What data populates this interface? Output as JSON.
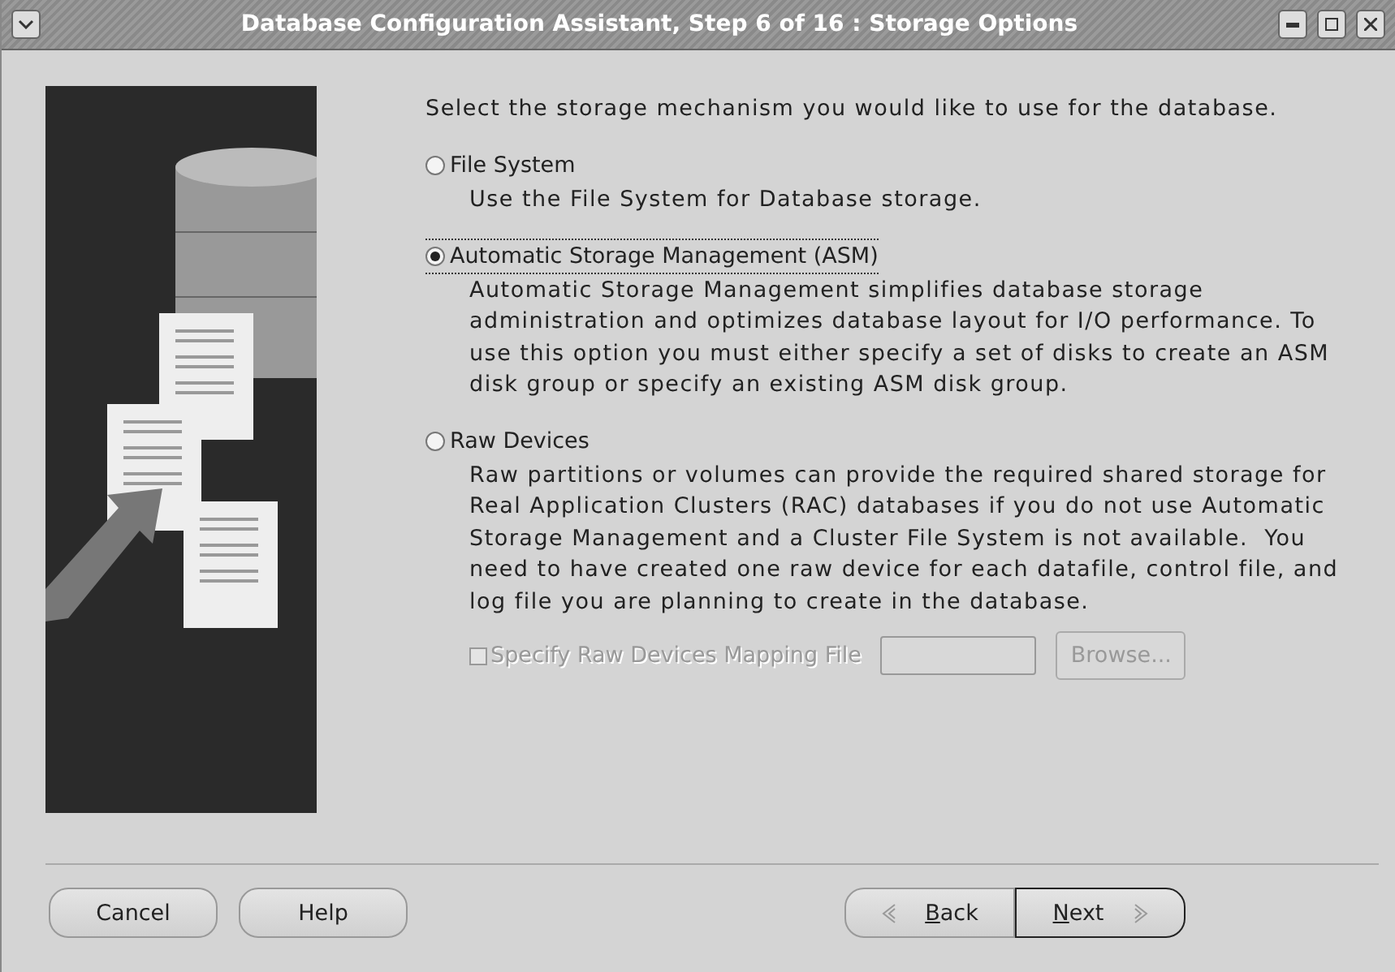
{
  "window": {
    "title": "Database Configuration Assistant, Step 6 of 16 : Storage Options"
  },
  "prompt": "Select the storage mechanism you would like to use for the database.",
  "options": [
    {
      "label": "File System",
      "description": "Use the File System for Database storage.",
      "selected": false,
      "focused": false
    },
    {
      "label": "Automatic Storage Management (ASM)",
      "description": "Automatic Storage Management simplifies database storage administration and optimizes database layout for I/O performance. To use this option you must either specify a set of disks to create an ASM disk group or specify an existing ASM disk group.",
      "selected": true,
      "focused": true
    },
    {
      "label": "Raw Devices",
      "description": "Raw partitions or volumes can provide the required shared storage for Real Application Clusters (RAC) databases if you do not use Automatic Storage Management and a Cluster File System is not available.  You need to have created one raw device for each datafile, control file, and log file you are planning to create in the database.",
      "selected": false,
      "focused": false
    }
  ],
  "mapping": {
    "label": "Specify Raw Devices Mapping File",
    "checked": false,
    "disabled": true,
    "browse": "Browse..."
  },
  "buttons": [
    {
      "label": "Cancel",
      "kind": "left",
      "mnemonic": false
    },
    {
      "label": "Help",
      "kind": "left",
      "mnemonic": false
    },
    {
      "label": "Back",
      "kind": "back",
      "mnemonic": true
    },
    {
      "label": "Next",
      "kind": "next",
      "mnemonic": true
    }
  ]
}
